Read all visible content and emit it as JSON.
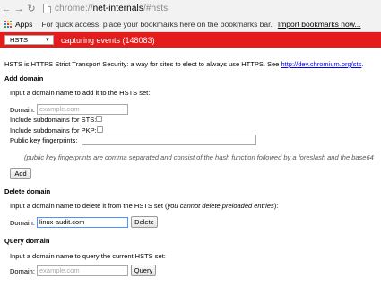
{
  "browser": {
    "url_scheme": "chrome://",
    "url_host": "net-internals",
    "url_path": "/#hsts"
  },
  "bookmarks_bar": {
    "apps_label": "Apps",
    "hint": "For quick access, place your bookmarks here on the bookmarks bar.",
    "import_link": "Import bookmarks now..."
  },
  "status_bar": {
    "view_select": "HSTS",
    "status_text": "capturing events (148083)",
    "color": "#e51c1c"
  },
  "intro": {
    "text": "HSTS is HTTPS Strict Transport Security: a way for sites to elect to always use HTTPS. See ",
    "link": "http://dev.chromium.org/sts",
    "suffix": "."
  },
  "add_domain": {
    "heading": "Add domain",
    "instruction": "Input a domain name to add it to the HSTS set:",
    "domain_label": "Domain:",
    "domain_placeholder": "example.com",
    "sts_label": "Include subdomains for STS:",
    "pkp_label": "Include subdomains for PKP:",
    "fingerprints_label": "Public key fingerprints:",
    "fingerprints_note": "(public key fingerprints are comma separated and consist of the hash function followed by a foreslash and the base64",
    "add_button": "Add"
  },
  "delete_domain": {
    "heading": "Delete domain",
    "instruction_prefix": "Input a domain name to delete it from the HSTS set (",
    "instruction_italic": "you cannot delete preloaded entries",
    "instruction_suffix": "):",
    "domain_label": "Domain:",
    "domain_value": "linux-audit.com",
    "delete_button": "Delete"
  },
  "query_domain": {
    "heading": "Query domain",
    "instruction": "Input a domain name to query the current HSTS set:",
    "domain_label": "Domain:",
    "domain_placeholder": "example.com",
    "query_button": "Query"
  }
}
